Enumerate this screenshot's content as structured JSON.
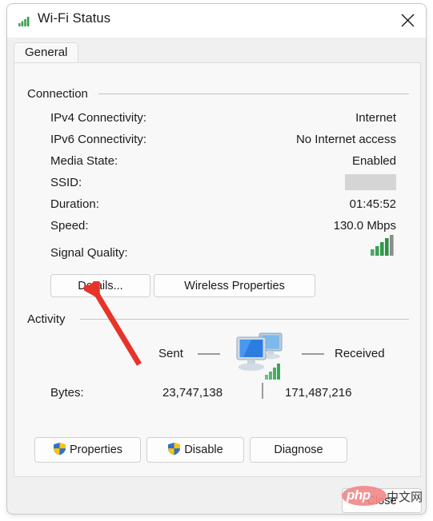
{
  "window": {
    "title": "Wi-Fi Status",
    "title_icon": "wifi-signal-icon",
    "close_icon": "close-x-icon"
  },
  "tabs": [
    {
      "label": "General",
      "selected": true
    }
  ],
  "connection": {
    "group_label": "Connection",
    "rows": [
      {
        "label": "IPv4 Connectivity:",
        "value": "Internet"
      },
      {
        "label": "IPv6 Connectivity:",
        "value": "No Internet access"
      },
      {
        "label": "Media State:",
        "value": "Enabled"
      },
      {
        "label": "SSID:",
        "value": "",
        "redacted": true
      },
      {
        "label": "Duration:",
        "value": "01:45:52"
      },
      {
        "label": "Speed:",
        "value": "130.0 Mbps"
      },
      {
        "label": "Signal Quality:",
        "value": "",
        "icon": "signal-bars-icon",
        "bars_filled": 4,
        "bars_total": 5
      }
    ],
    "buttons": [
      {
        "label": "Details...",
        "name": "details-button"
      },
      {
        "label": "Wireless Properties",
        "name": "wireless-properties-button"
      }
    ]
  },
  "activity": {
    "group_label": "Activity",
    "sent_label": "Sent",
    "received_label": "Received",
    "center_icon": "two-computers-network-icon",
    "bytes_label": "Bytes:",
    "bytes_sent": "23,747,138",
    "bytes_received": "171,487,216"
  },
  "footer_buttons": [
    {
      "label": "Properties",
      "name": "properties-button",
      "icon": "uac-shield-icon"
    },
    {
      "label": "Disable",
      "name": "disable-button",
      "icon": "uac-shield-icon"
    },
    {
      "label": "Diagnose",
      "name": "diagnose-button",
      "icon": null
    }
  ],
  "close_button": {
    "label": "Close"
  },
  "annotation": {
    "arrow_color": "#e8332a",
    "points_to": "details-button"
  },
  "watermark": {
    "brand": "php",
    "suffix": "中文网",
    "ellipse_color": "#f08a8a"
  },
  "colors": {
    "window_bg": "#f0f0f0",
    "panel_bg": "#f8f8f8",
    "titlebar_bg": "#ffffff",
    "text": "#1b1b1b",
    "rule": "#c4c4c4",
    "redaction": "#d5d5d5",
    "signal_green": "#3c9c52",
    "signal_gray": "#8c8c8c",
    "accent_red": "#e8332a"
  }
}
